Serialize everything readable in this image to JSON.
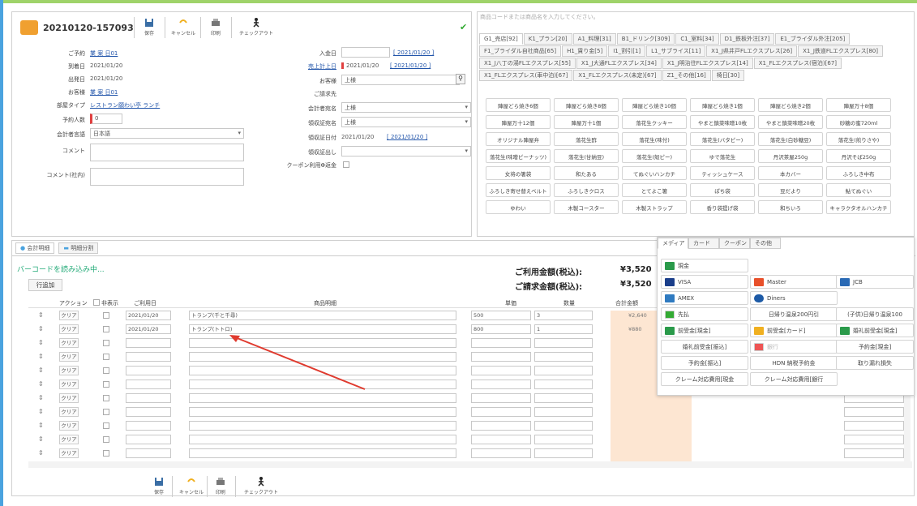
{
  "header": {
    "order_id": "20210120-157093",
    "checkmark": "✔"
  },
  "toolbar": {
    "save": "保存",
    "cancel": "キャンセル",
    "print": "印刷",
    "checkout": "チェックアウト"
  },
  "form_left": {
    "reservation_label": "ご予約",
    "reservation_value": "業 案 日01",
    "arrival_label": "到着日",
    "arrival_value": "2021/01/20",
    "departure_label": "出発日",
    "departure_value": "2021/01/20",
    "customer_label": "お客様",
    "customer_value": "業 案 日01",
    "room_type_label": "部屋タイプ",
    "room_type_value": "レストラン願わい亭 ランチ",
    "guests_label": "予約人数",
    "guests_value": "0",
    "lang_label": "会計者言語",
    "lang_value": "日本語",
    "comment_label": "コメント",
    "comment_internal_label": "コメント(社内)"
  },
  "form_right": {
    "payment_date_label": "入金日",
    "payment_date_value": "[ 2021/01/20 ]",
    "sales_date_label": "売上計上日",
    "sales_date_value": "2021/01/20",
    "sales_date_link": "[ 2021/01/20 ]",
    "customer_label": "お客様",
    "customer_value": "上様",
    "billing_label": "ご請求先",
    "account_name_label": "会計者宛名",
    "account_name_value": "上様",
    "receipt_name_label": "領収証宛名",
    "receipt_name_value": "上様",
    "receipt_date_label": "領収証日付",
    "receipt_date_value": "2021/01/20",
    "receipt_date_link": "[ 2021/01/20 ]",
    "receipt_issue_label": "領収証出し",
    "coupon_label": "クーポン利用Φ返金"
  },
  "products": {
    "search_placeholder": "商品コードまたは商品名を入力してください。",
    "tabs": [
      "G1_売店[92]",
      "K1_プラン[20]",
      "A1_料理[31]",
      "B1_ドリンク[309]",
      "C1_室料[34]",
      "D1_鉄板外注[37]",
      "E1_ブライダル外注[205]",
      "F1_ブライダル自社商品[65]",
      "H1_賃り金[5]",
      "I1_割引[1]",
      "L1_サブライス[11]",
      "X1_J県井戸FLエクスプレス[26]",
      "X1_J鉄道FLエクスプレス[80]",
      "X1_J八丁の湯FLエクスプレス[55]",
      "X1_J大通FLエクスプレス[34]",
      "X1_J明治往FLエクスプレス[14]",
      "X1_FLエクスプレス(宿泊)[67]",
      "X1_FLエクスプレス(車中泊)[67]",
      "X1_FLエクスプレス(未定)[67]",
      "Z1_その他[16]",
      "椅日[30]"
    ],
    "items": [
      "陣屋どら焼き6個",
      "陣屋どら焼き8個",
      "陣屋どら焼き10個",
      "陣屋どら焼き1個",
      "陣屋どら焼き2個",
      "陣屋万十8個",
      "陣屋万十12個",
      "陣屋万十1個",
      "落花生クッキー",
      "やまと鎮菜味噌10枚",
      "やまと鎮菜味噌20枚",
      "砂糖の蜜720ml",
      "オリジナル陣屋弁",
      "落花生酢",
      "落花生(味付)",
      "落花生(バタピー)",
      "落花生(白砂糖豆)",
      "落花生(煎りさや)",
      "落花生(味噌ピーナッツ)",
      "落花生(甘納豆)",
      "落花生(殻ピー)",
      "ゆで落花生",
      "丹沢茶屋250g",
      "丹沢そば250g",
      "女将の箸袋",
      "和たある",
      "てぬぐいハンカチ",
      "ティッシュケース",
      "本カバー",
      "ふろしき中布",
      "ふろしき寄せ替えベルト",
      "ふろしきクロス",
      "とてよこ箸",
      "ぽち袋",
      "豆だより",
      "鮎てぬぐい",
      "ゆわい",
      "木製コースター",
      "木製ストラップ",
      "香り袋提げ袋",
      "和ちいろ",
      "キャラクタオルハンカチ"
    ]
  },
  "bottom_tabs": {
    "tab1": "会計明細",
    "tab2": "明細分割"
  },
  "status": {
    "barcode": "バーコードを読み込み中...",
    "add_row": "行追加"
  },
  "summary": {
    "usage_label": "ご利用金額(税込):",
    "usage_value": "¥3,520",
    "bill_label": "ご請求金額(税込):",
    "bill_value": "¥3,520"
  },
  "table": {
    "headers": [
      "アクション",
      "非表示",
      "ご利用日",
      "商品明細",
      "単価",
      "数量",
      "合計金額"
    ],
    "clear": "クリア",
    "rows": [
      {
        "date": "2021/01/20",
        "item": "トランプ(千と千尋)",
        "price": "500",
        "qty": "3",
        "total": "¥2,640"
      },
      {
        "date": "2021/01/20",
        "item": "トランプ(トトロ)",
        "price": "800",
        "qty": "1",
        "total": "¥880"
      },
      {
        "date": "",
        "item": "",
        "price": "",
        "qty": "",
        "total": ""
      },
      {
        "date": "",
        "item": "",
        "price": "",
        "qty": "",
        "total": ""
      },
      {
        "date": "",
        "item": "",
        "price": "",
        "qty": "",
        "total": ""
      },
      {
        "date": "",
        "item": "",
        "price": "",
        "qty": "",
        "total": ""
      },
      {
        "date": "",
        "item": "",
        "price": "",
        "qty": "",
        "total": ""
      },
      {
        "date": "",
        "item": "",
        "price": "",
        "qty": "",
        "total": ""
      },
      {
        "date": "",
        "item": "",
        "price": "",
        "qty": "",
        "total": ""
      },
      {
        "date": "",
        "item": "",
        "price": "",
        "qty": "",
        "total": ""
      },
      {
        "date": "",
        "item": "",
        "price": "",
        "qty": "",
        "total": ""
      }
    ]
  },
  "payment": {
    "tabs": [
      "メディア",
      "カード",
      "クーポン",
      "その他"
    ],
    "cash": "現金",
    "visa": "VISA",
    "master": "Master",
    "jcb": "JCB",
    "amex": "AMEX",
    "diners": "Diners",
    "advance": "先払",
    "hot_spring": "日帰り温泉200円引",
    "child_hot_spring": "(子供)日帰り温泉100",
    "deposit_cash": "前受金[現金]",
    "deposit_card": "前受金[カード]",
    "gift_deposit_cash": "婚礼前受金[現金]",
    "gift_deposit_transfer": "婚礼前受金[振込]",
    "mobile": "銀行",
    "reserve_cash": "予約金[現金]",
    "reserve_transfer": "予約金[振込]",
    "hdn": "HDN 納税予約金",
    "unpaid": "取り漏れ損失",
    "claim_cash": "クレーム対応費用[現金",
    "claim_bank": "クレーム対応費用[銀行"
  },
  "colors": {
    "accent_green": "#9fd36a",
    "accent_blue": "#4aa3df",
    "peach": "#fde6d2",
    "arrow": "#e03a2e"
  }
}
